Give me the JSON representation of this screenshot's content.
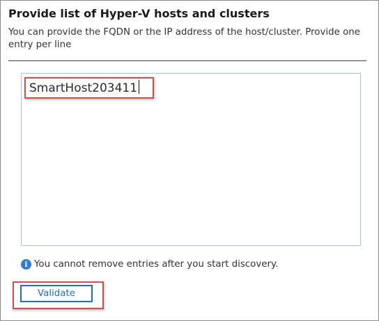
{
  "section": {
    "title": "Provide list of Hyper-V hosts and clusters",
    "description": "You can provide the FQDN or the IP address of the host/cluster. Provide one entry per line"
  },
  "hosts_input": {
    "value": "SmartHost203411"
  },
  "info": {
    "icon": "info-icon",
    "text": "You cannot remove entries after you start discovery."
  },
  "actions": {
    "validate_label": "Validate"
  },
  "colors": {
    "accent": "#1b6fbf",
    "highlight": "#e0493f",
    "input_border": "#9fc7e8"
  }
}
